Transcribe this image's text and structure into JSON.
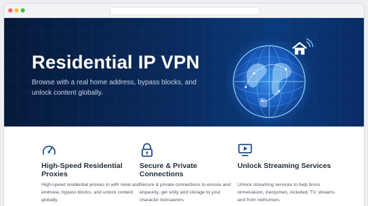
{
  "hero": {
    "title": "Residential IP VPN",
    "subtitle": "Browse with a real home address, bypass blocks, and unlock content globally."
  },
  "features": [
    {
      "icon": "speedometer-icon",
      "title": "High-Speed Residential Proxies",
      "description": "High-speed residential proxies in with meal and endrvew, bypass blocks, and unlock content globally."
    },
    {
      "icon": "padlock-icon",
      "title": "Secure & Private Connections",
      "description": "Secure & private connections to ensure and enpeurity, get unity and storage to your character bonsasrers."
    },
    {
      "icon": "tv-play-icon",
      "title": "Unlock Streaming Services",
      "description": "Unlock streaming services to help broro ormeivasion, inerqumes, included, TV, streams and from nethumers."
    }
  ],
  "colors": {
    "hero_bg": "#0a2a5c",
    "globe_accent": "#4fb6ff",
    "icon_blue": "#1f4f8f"
  }
}
